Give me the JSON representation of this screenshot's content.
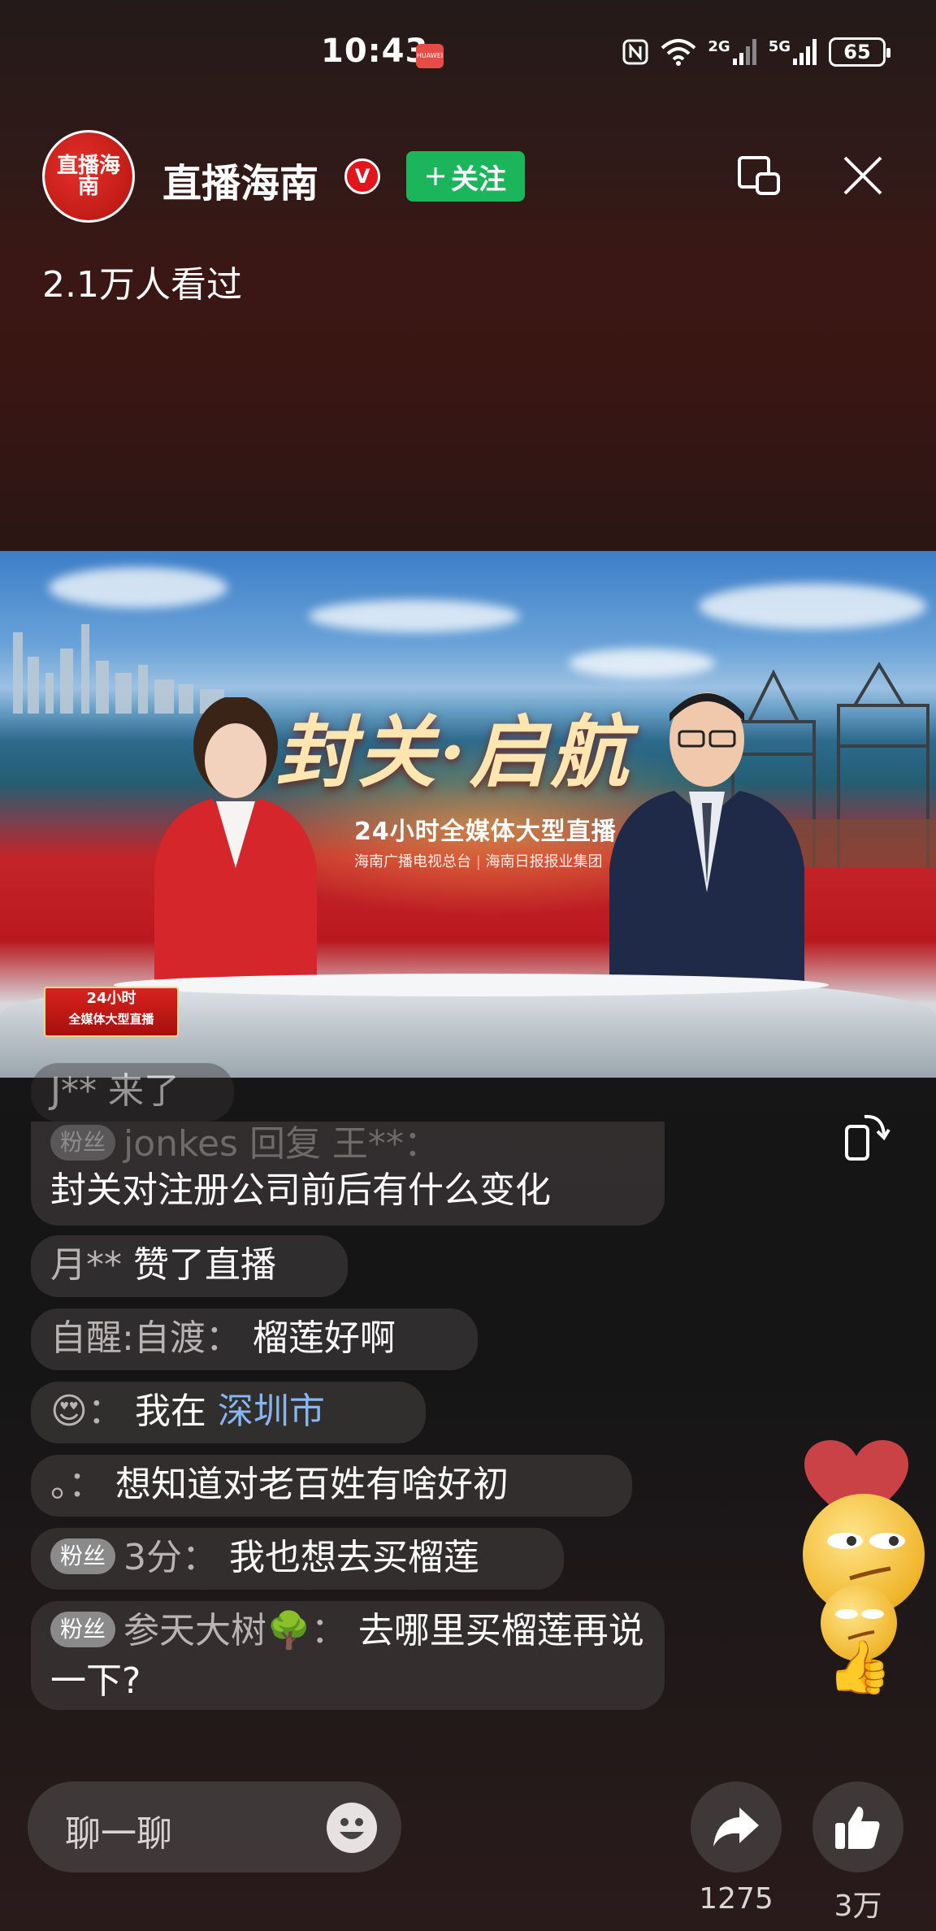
{
  "status_bar": {
    "time": "10:43",
    "brand": "HUAWEI",
    "network_1": "2G",
    "network_2": "5G",
    "battery": "65"
  },
  "header": {
    "channel_name": "直播海南",
    "avatar_text": "直播海南",
    "verified_badge": "V",
    "follow_label": "关注",
    "viewers": "2.1万人看过"
  },
  "video": {
    "title": "封关·启航",
    "subtitle": "24小时全媒体大型直播",
    "org_1": "海南广播电视总台",
    "org_2": "海南日报报业集团",
    "corner_badge_line1": "24小时",
    "corner_badge_line2": "全媒体大型直播"
  },
  "chat": [
    {
      "name": "J**",
      "text": "来了",
      "fan": false
    },
    {
      "name": "jonkes 回复 王**：",
      "text": "封关对注册公司前后有什么变化",
      "fan": true
    },
    {
      "name": "月**",
      "text": "赞了直播",
      "fan": false
    },
    {
      "name": "自醒:自渡：",
      "text": "榴莲好啊",
      "fan": false
    },
    {
      "name": "😍：",
      "text": "我在",
      "location": "深圳市",
      "fan": false
    },
    {
      "name": "。：",
      "text": "想知道对老百姓有啥好初",
      "fan": false
    },
    {
      "name": "3分：",
      "text": "我也想去买榴莲",
      "fan": true
    },
    {
      "name": "参天大树🌳：",
      "text": "去哪里买榴莲再说一下?",
      "fan": true
    }
  ],
  "fan_label": "粉丝",
  "bottom_bar": {
    "chat_placeholder": "聊一聊",
    "share_count": "1275",
    "like_count": "3万"
  },
  "colors": {
    "follow_green": "#1bb55c",
    "verified_red": "#e0161c",
    "location_blue": "#86b7f2"
  }
}
